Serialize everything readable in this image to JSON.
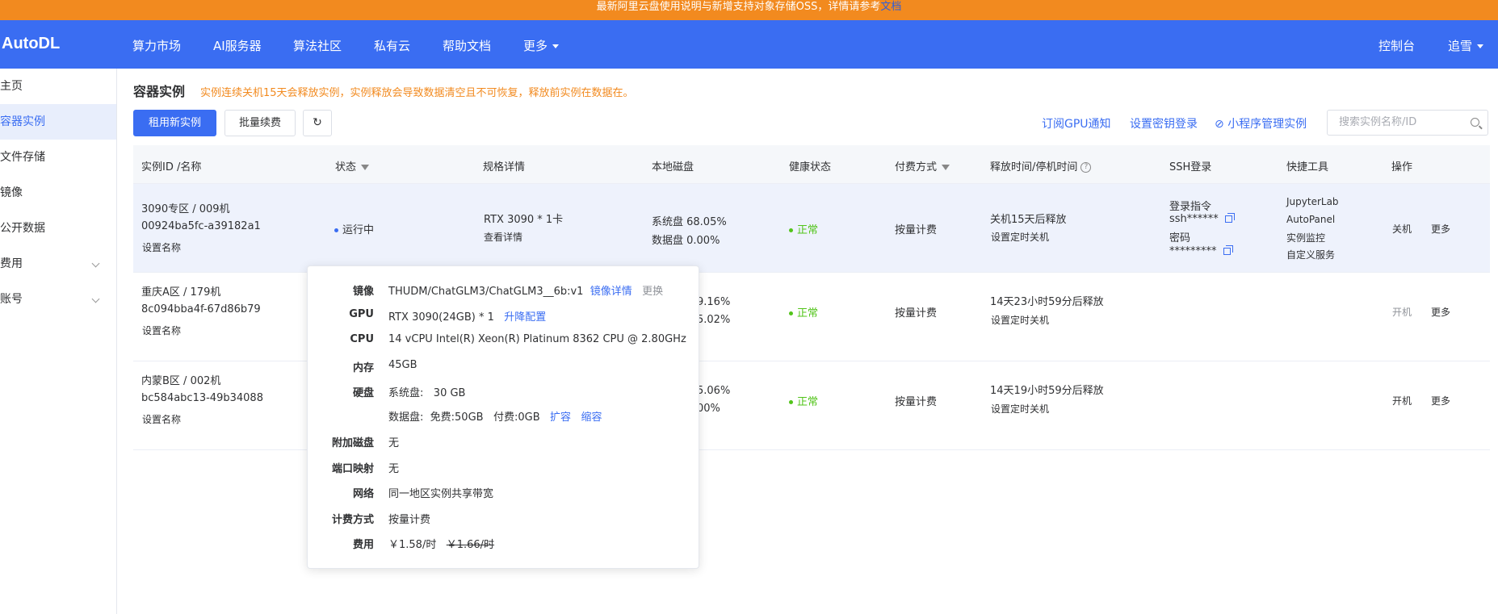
{
  "notice": {
    "text": "最新阿里云盘使用说明与新增支持对象存储OSS，详情请参考",
    "link": "文档"
  },
  "nav": {
    "logo": "AutoDL",
    "items": [
      "算力市场",
      "AI服务器",
      "算法社区",
      "私有云",
      "帮助文档",
      "更多"
    ],
    "console": "控制台",
    "user": "追雪"
  },
  "sidebar": {
    "items": [
      {
        "label": "主页"
      },
      {
        "label": "容器实例"
      },
      {
        "label": "文件存储"
      },
      {
        "label": "镜像"
      },
      {
        "label": "公开数据"
      },
      {
        "label": "费用"
      },
      {
        "label": "账号"
      }
    ]
  },
  "main": {
    "title": "容器实例",
    "warning": "实例连续关机15天会释放实例，实例释放会导致数据清空且不可恢复，释放前实例在数据在。",
    "rent_button": "租用新实例",
    "renew_button": "批量续费",
    "links": [
      "订阅GPU通知",
      "设置密钥登录",
      "小程序管理实例"
    ],
    "search_placeholder": "搜索实例名称/ID"
  },
  "table": {
    "headers": [
      "实例ID /名称",
      "状态",
      "规格详情",
      "本地磁盘",
      "健康状态",
      "付费方式",
      "释放时间/停机时间",
      "SSH登录",
      "快捷工具",
      "操作"
    ],
    "rows": [
      {
        "name": "3090专区 / 009机",
        "id": "00924ba5fc-a39182a1",
        "set_name": "设置名称",
        "status": "运行中",
        "spec": "RTX 3090 * 1卡",
        "spec_link": "查看详情",
        "disk_sys": "系统盘 68.05%",
        "disk_data": "数据盘 0.00%",
        "health": "正常",
        "pay": "按量计费",
        "release": "关机15天后释放",
        "release_link": "设置定时关机",
        "ssh_cmd_label": "登录指令",
        "ssh_cmd": "ssh******",
        "ssh_pwd_label": "密码",
        "ssh_pwd": "*********",
        "tools": [
          "JupyterLab",
          "AutoPanel",
          "实例监控",
          "自定义服务"
        ],
        "op1": "关机",
        "op2": "更多"
      },
      {
        "name": "重庆A区 / 179机",
        "id": "8c094bba4f-67d86b79",
        "set_name": "设置名称",
        "disk_sys": "9.16%",
        "disk_data": "5.02%",
        "health": "正常",
        "pay": "按量计费",
        "release": "14天23小时59分后释放",
        "release_link": "设置定时关机",
        "op1": "开机",
        "op2": "更多"
      },
      {
        "name": "内蒙B区 / 002机",
        "id": "bc584abc13-49b34088",
        "set_name": "设置名称",
        "disk_sys": "5.06%",
        "disk_data": "00%",
        "health": "正常",
        "pay": "按量计费",
        "release": "14天19小时59分后释放",
        "release_link": "设置定时关机",
        "op1": "开机",
        "op2": "更多"
      }
    ]
  },
  "popover": {
    "image_label": "镜像",
    "image": "THUDM/ChatGLM3/ChatGLM3__6b:v1",
    "image_detail": "镜像详情",
    "image_change": "更换",
    "gpu_label": "GPU",
    "gpu": "RTX 3090(24GB) * 1",
    "gpu_upgrade": "升降配置",
    "cpu_label": "CPU",
    "cpu": "14 vCPU Intel(R) Xeon(R) Platinum 8362 CPU @ 2.80GHz",
    "mem_label": "内存",
    "mem": "45GB",
    "disk_label": "硬盘",
    "disk_sys_label": "系统盘:",
    "disk_sys": "30 GB",
    "disk_data_label": "数据盘:",
    "disk_free": "免费:50GB",
    "disk_paid": "付费:0GB",
    "expand": "扩容",
    "shrink": "缩容",
    "extra_disk_label": "附加磁盘",
    "extra_disk": "无",
    "port_label": "端口映射",
    "port": "无",
    "net_label": "网络",
    "net": "同一地区实例共享带宽",
    "billing_label": "计费方式",
    "billing": "按量计费",
    "fee_label": "费用",
    "fee": "￥1.58/时",
    "fee_orig": "￥1.66/时"
  }
}
